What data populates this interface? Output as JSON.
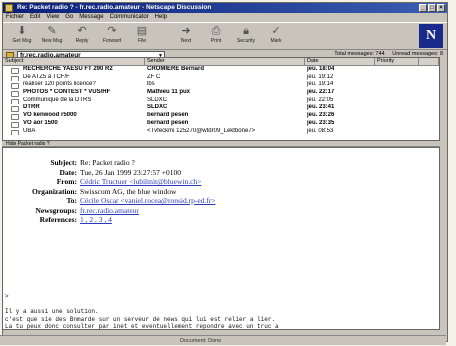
{
  "window": {
    "title": "Re: Packet radio ? - fr.rec.radio.amateur - Netscape Discussion"
  },
  "menu": [
    "Fichier",
    "Edit",
    "View",
    "Go",
    "Message",
    "Communicator",
    "Help"
  ],
  "toolbar": [
    "Get Msg",
    "New Msg",
    "Reply",
    "Forward",
    "File",
    "Next",
    "Print",
    "Security",
    "Mark"
  ],
  "folder": {
    "name": "fr.rec.radio.amateur"
  },
  "stats": {
    "total": "Total messages: 744",
    "unread": "Unread messages: 8"
  },
  "columns": [
    "Subject",
    "Sender",
    "Date",
    "Priority"
  ],
  "messages": [
    {
      "subject": "RECHERCHE YAESU FT 290 R2",
      "sender": "CROMIERE Bernard",
      "date": "jeu. 18:04",
      "bold": true
    },
    {
      "subject": "De ATZ5 à TCF/F",
      "sender": "ZF C",
      "date": "jeu. 19:12",
      "bold": false
    },
    {
      "subject": "réaliser 120 points licence?",
      "sender": "lbs",
      "date": "jeu. 19:14",
      "bold": false
    },
    {
      "subject": "PHOTOS * CONTEST * VUS/HF",
      "sender": "Mathieu 11 pux",
      "date": "jeu. 22:17",
      "bold": true
    },
    {
      "subject": "Communiqué de la DTRS",
      "sender": "SLDXC",
      "date": "jeu. 22:05",
      "bold": false
    },
    {
      "subject": "DTRR",
      "sender": "SLDXC",
      "date": "jeu. 23:41",
      "bold": true
    },
    {
      "subject": "VO kenwood r5000",
      "sender": "bernard pesen",
      "date": "jeu. 23:26",
      "bold": true
    },
    {
      "subject": "VO aor 1500",
      "sender": "bernard pesen",
      "date": "jeu. 23:35",
      "bold": true
    },
    {
      "subject": "UBA",
      "sender": "<Tvfeckmi 125270@wtdr09_Lektbone7>",
      "date": "jeu. 08:53",
      "bold": false
    }
  ],
  "pane_label": "Hide Packet radio ?",
  "headers": {
    "subject_label": "Subject:",
    "subject": "Re: Packet radio ?",
    "date_label": "Date:",
    "date": "Tue, 26 Jan 1999 23:27:57 +0100",
    "from_label": "From:",
    "from": "Cédric Tructuer <lubilmit@bluewin.ch>",
    "org_label": "Organization:",
    "org": "Swisscom AG, the blue window",
    "to_label": "To:",
    "to": "Cécile Oscar <vaniel.rocea@ronsid.rp-ed.fr>",
    "newsgroups_label": "Newsgroups:",
    "newsgroups": "fr.rec.radio.amateur",
    "references_label": "References:",
    "references": "1 , 2 , 3 , 4"
  },
  "body_text": ">\n\nIl y a aussi une solution.\nc'est que sie des Bnmarde sur un serveur de news qui lui est relier a lier.\nLa tu peux donc consulter par inet et eventuellement repondre avec un truc a",
  "status": "Document: Done"
}
